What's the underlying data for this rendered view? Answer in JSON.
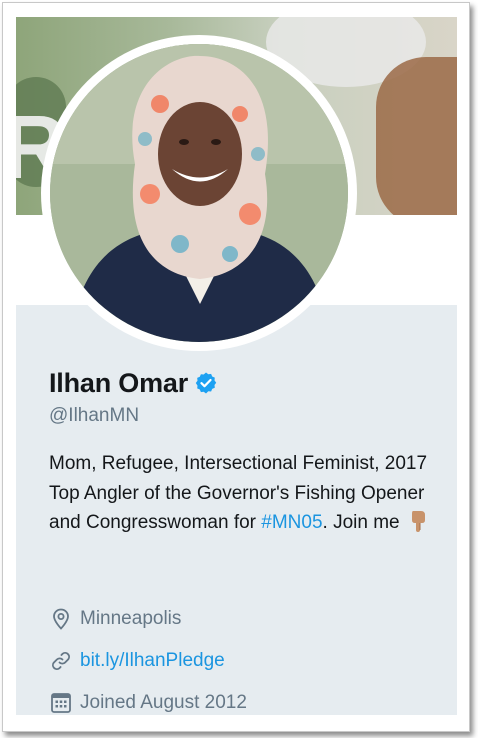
{
  "profile": {
    "name": "Ilhan Omar",
    "handle": "@IlhanMN",
    "verified_icon": "verified-badge-icon",
    "bio": {
      "text": "Mom, Refugee, Intersectional Feminist, 2017 Top Angler of the Governor's Fishing Opener and Congresswoman for ",
      "hashtag": "#MN05",
      "suffix": ". Join me",
      "emoji_icon": "pointing-down-hand-icon"
    },
    "location": {
      "icon": "location-pin-icon",
      "text": "Minneapolis"
    },
    "url": {
      "icon": "link-icon",
      "text": "bit.ly/IlhanPledge"
    },
    "joined": {
      "icon": "calendar-icon",
      "text": "Joined August 2012"
    }
  },
  "colors": {
    "card_background": "#e6ecf0",
    "link_blue": "#1b95e0",
    "secondary_text": "#657786",
    "primary_text": "#14171a"
  }
}
